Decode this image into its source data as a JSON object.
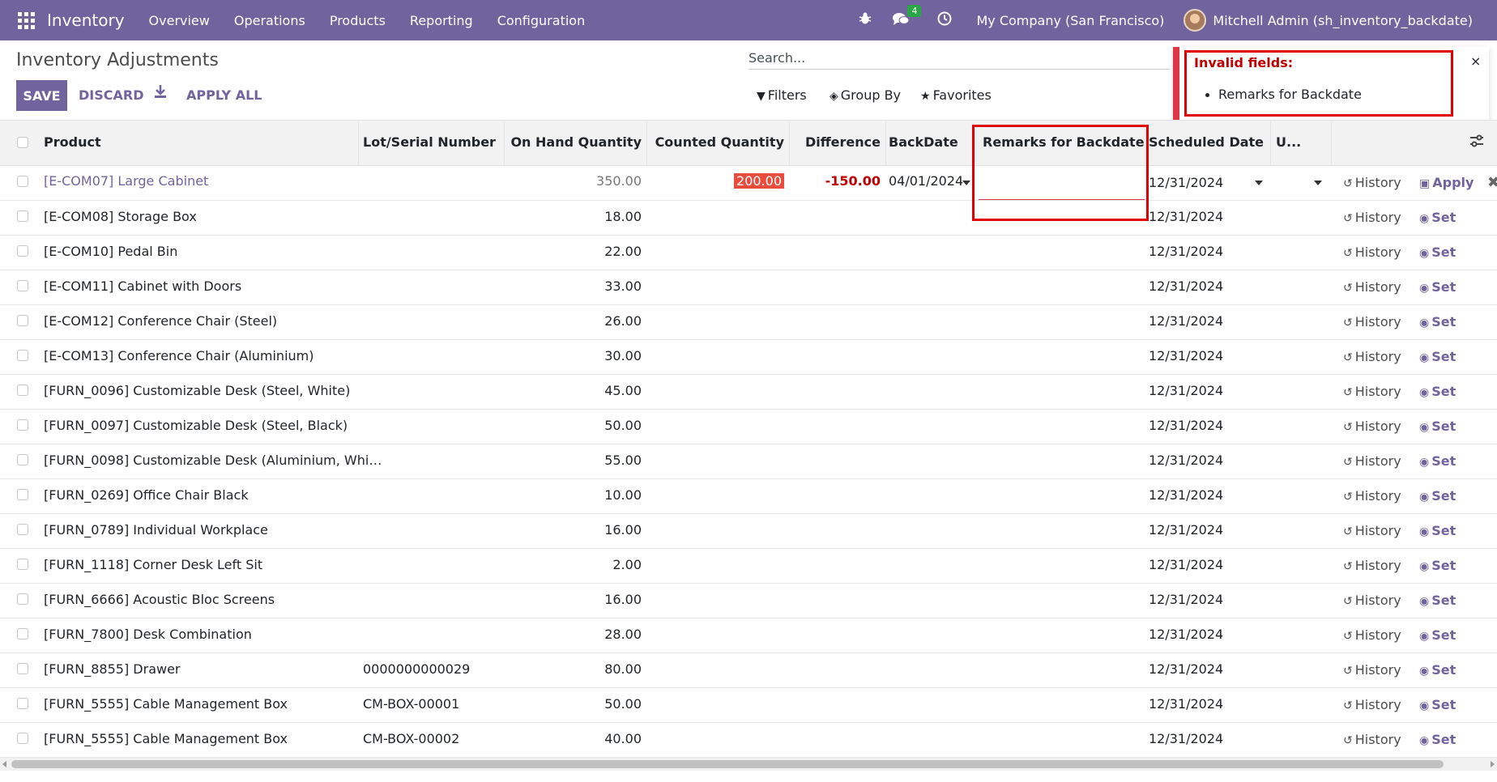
{
  "navbar": {
    "app_name": "Inventory",
    "menus": [
      "Overview",
      "Operations",
      "Products",
      "Reporting",
      "Configuration"
    ],
    "message_count": "4",
    "company": "My Company (San Francisco)",
    "user": "Mitchell Admin (sh_inventory_backdate)",
    "icons": [
      "apps-grid-icon",
      "bug-icon",
      "chat-icon",
      "clock-icon"
    ]
  },
  "control": {
    "title": "Inventory Adjustments",
    "save": "SAVE",
    "discard": "DISCARD",
    "apply_all": "APPLY ALL",
    "search_placeholder": "Search...",
    "filters": "Filters",
    "group_by": "Group By",
    "favorites": "Favorites"
  },
  "notification": {
    "title": "Invalid fields:",
    "items": [
      "Remarks for Backdate"
    ],
    "close": "×"
  },
  "columns": {
    "product": "Product",
    "lot": "Lot/Serial Number",
    "on_hand": "On Hand Quantity",
    "counted": "Counted Quantity",
    "difference": "Difference",
    "backdate": "BackDate",
    "remarks": "Remarks for Backdate",
    "scheduled": "Scheduled Date",
    "user": "U..."
  },
  "edit_row": {
    "product": "[E-COM07] Large Cabinet",
    "on_hand": "350.00",
    "counted": "200.00",
    "difference": "-150.00",
    "backdate": "04/01/2024",
    "scheduled": "12/31/2024",
    "history": "History",
    "apply": "Apply"
  },
  "rows": [
    {
      "product": "[E-COM08] Storage Box",
      "lot": "",
      "on_hand": "18.00",
      "scheduled": "12/31/2024",
      "history": "History",
      "set": "Set"
    },
    {
      "product": "[E-COM10] Pedal Bin",
      "lot": "",
      "on_hand": "22.00",
      "scheduled": "12/31/2024",
      "history": "History",
      "set": "Set"
    },
    {
      "product": "[E-COM11] Cabinet with Doors",
      "lot": "",
      "on_hand": "33.00",
      "scheduled": "12/31/2024",
      "history": "History",
      "set": "Set"
    },
    {
      "product": "[E-COM12] Conference Chair (Steel)",
      "lot": "",
      "on_hand": "26.00",
      "scheduled": "12/31/2024",
      "history": "History",
      "set": "Set"
    },
    {
      "product": "[E-COM13] Conference Chair (Aluminium)",
      "lot": "",
      "on_hand": "30.00",
      "scheduled": "12/31/2024",
      "history": "History",
      "set": "Set"
    },
    {
      "product": "[FURN_0096] Customizable Desk (Steel, White)",
      "lot": "",
      "on_hand": "45.00",
      "scheduled": "12/31/2024",
      "history": "History",
      "set": "Set"
    },
    {
      "product": "[FURN_0097] Customizable Desk (Steel, Black)",
      "lot": "",
      "on_hand": "50.00",
      "scheduled": "12/31/2024",
      "history": "History",
      "set": "Set"
    },
    {
      "product": "[FURN_0098] Customizable Desk (Aluminium, Whi…",
      "lot": "",
      "on_hand": "55.00",
      "scheduled": "12/31/2024",
      "history": "History",
      "set": "Set"
    },
    {
      "product": "[FURN_0269] Office Chair Black",
      "lot": "",
      "on_hand": "10.00",
      "scheduled": "12/31/2024",
      "history": "History",
      "set": "Set"
    },
    {
      "product": "[FURN_0789] Individual Workplace",
      "lot": "",
      "on_hand": "16.00",
      "scheduled": "12/31/2024",
      "history": "History",
      "set": "Set"
    },
    {
      "product": "[FURN_1118] Corner Desk Left Sit",
      "lot": "",
      "on_hand": "2.00",
      "scheduled": "12/31/2024",
      "history": "History",
      "set": "Set"
    },
    {
      "product": "[FURN_6666] Acoustic Bloc Screens",
      "lot": "",
      "on_hand": "16.00",
      "scheduled": "12/31/2024",
      "history": "History",
      "set": "Set"
    },
    {
      "product": "[FURN_7800] Desk Combination",
      "lot": "",
      "on_hand": "28.00",
      "scheduled": "12/31/2024",
      "history": "History",
      "set": "Set"
    },
    {
      "product": "[FURN_8855] Drawer",
      "lot": "0000000000029",
      "on_hand": "80.00",
      "scheduled": "12/31/2024",
      "history": "History",
      "set": "Set"
    },
    {
      "product": "[FURN_5555] Cable Management Box",
      "lot": "CM-BOX-00001",
      "on_hand": "50.00",
      "scheduled": "12/31/2024",
      "history": "History",
      "set": "Set"
    },
    {
      "product": "[FURN_5555] Cable Management Box",
      "lot": "CM-BOX-00002",
      "on_hand": "40.00",
      "scheduled": "12/31/2024",
      "history": "History",
      "set": "Set"
    }
  ],
  "colors": {
    "brand": "#71639e",
    "danger": "#dc3545",
    "highlight_frame": "#e00000"
  }
}
